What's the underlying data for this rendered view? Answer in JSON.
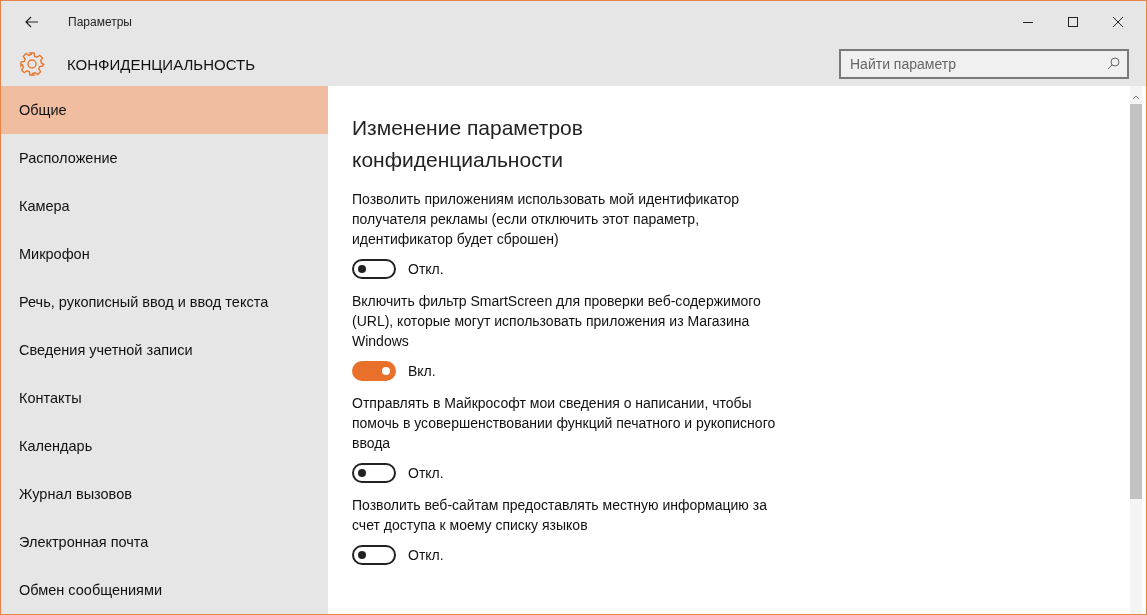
{
  "window": {
    "title": "Параметры"
  },
  "header": {
    "title": "КОНФИДЕНЦИАЛЬНОСТЬ"
  },
  "search": {
    "placeholder": "Найти параметр"
  },
  "sidebar": {
    "items": [
      {
        "label": "Общие",
        "selected": true
      },
      {
        "label": "Расположение",
        "selected": false
      },
      {
        "label": "Камера",
        "selected": false
      },
      {
        "label": "Микрофон",
        "selected": false
      },
      {
        "label": "Речь, рукописный ввод и ввод текста",
        "selected": false
      },
      {
        "label": "Сведения учетной записи",
        "selected": false
      },
      {
        "label": "Контакты",
        "selected": false
      },
      {
        "label": "Календарь",
        "selected": false
      },
      {
        "label": "Журнал вызовов",
        "selected": false
      },
      {
        "label": "Электронная почта",
        "selected": false
      },
      {
        "label": "Обмен сообщениями",
        "selected": false
      }
    ]
  },
  "content": {
    "heading": "Изменение параметров конфиденциальности",
    "settings": [
      {
        "description": "Позволить приложениям использовать мой идентификатор получателя рекламы (если отключить этот параметр, идентификатор будет сброшен)",
        "on": false,
        "state_label": "Откл."
      },
      {
        "description": "Включить фильтр SmartScreen для проверки веб-содержимого (URL), которые могут использовать приложения из Магазина Windows",
        "on": true,
        "state_label": "Вкл."
      },
      {
        "description": "Отправлять в Майкрософт мои сведения о написании, чтобы помочь в усовершенствовании функций печатного и рукописного ввода",
        "on": false,
        "state_label": "Откл."
      },
      {
        "description": "Позволить веб-сайтам предоставлять местную информацию за счет доступа к моему списку языков",
        "on": false,
        "state_label": "Откл."
      }
    ]
  }
}
